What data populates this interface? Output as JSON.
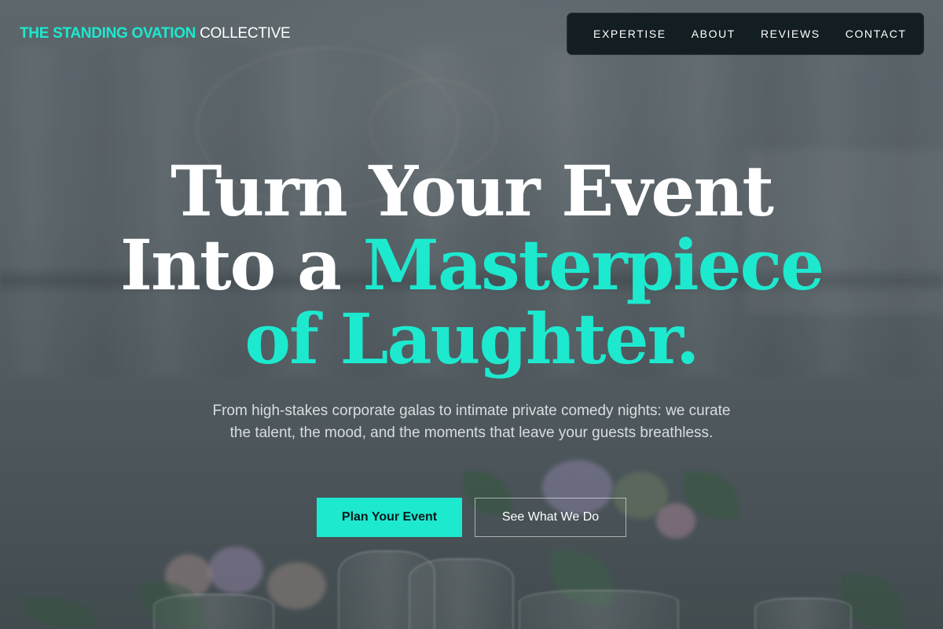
{
  "brand": {
    "name_accent": "THE STANDING OVATION",
    "name_rest": "COLLECTIVE"
  },
  "nav": {
    "items": [
      "EXPERTISE",
      "ABOUT",
      "REVIEWS",
      "CONTACT"
    ]
  },
  "hero": {
    "title_line1": "Turn Your Event",
    "title_line2_plain": "Into a",
    "title_line2_highlight": "Masterpiece",
    "title_line3_highlight": "of Laughter.",
    "subtitle": "From high-stakes corporate galas to intimate private comedy nights: we curate the talent, the mood, and the moments that leave your guests breathless.",
    "primary_cta": "Plan Your Event",
    "secondary_cta": "See What We Do"
  },
  "colors": {
    "accent": "#1de9cf",
    "nav_background": "#0b161b",
    "text": "#ffffff"
  }
}
